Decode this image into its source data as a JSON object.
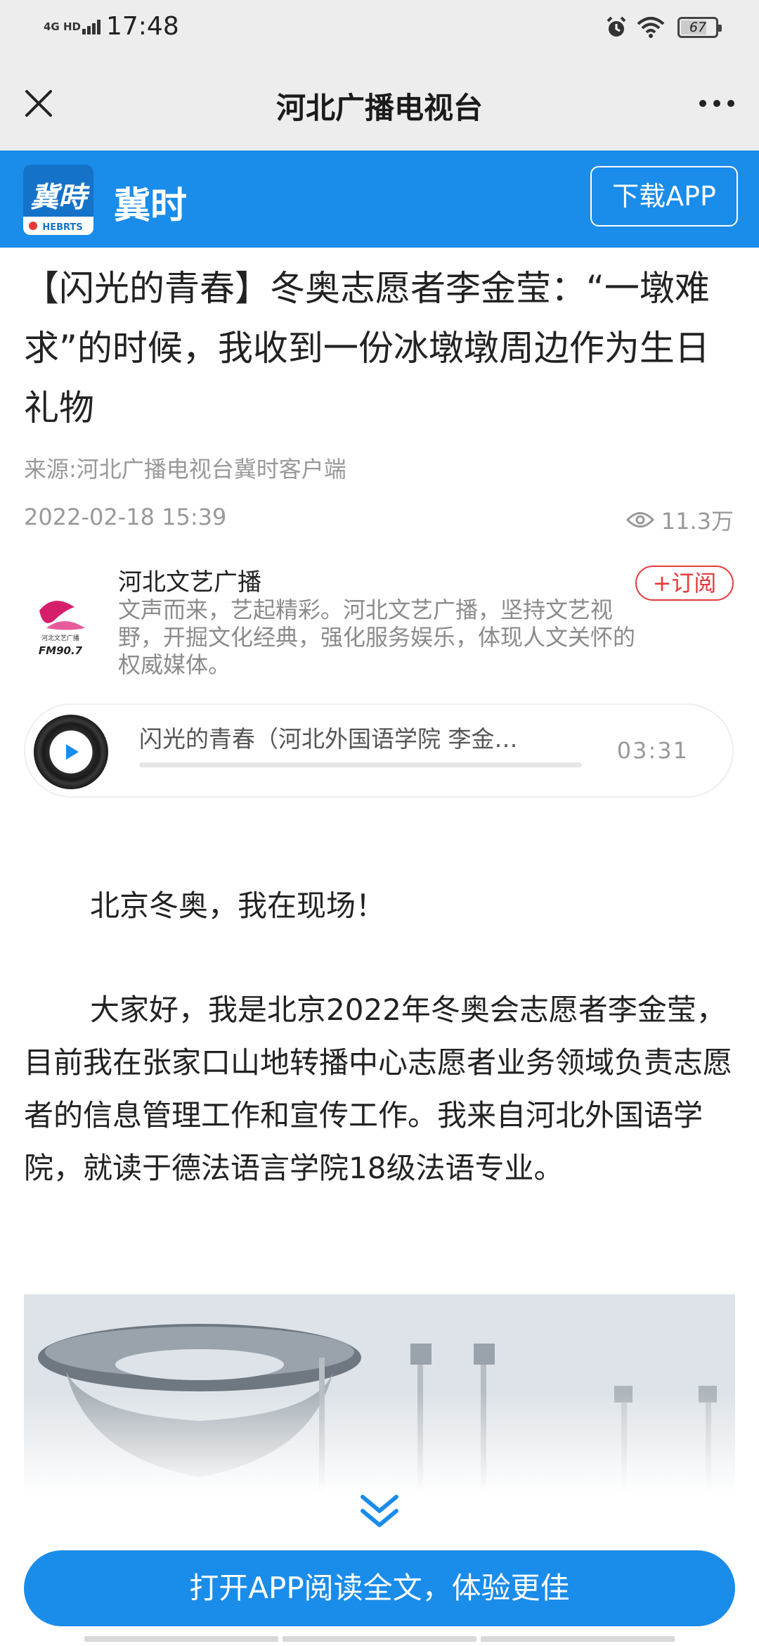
{
  "status_bar": {
    "network": "4G HD",
    "time": "17:48",
    "battery": "67"
  },
  "nav": {
    "title": "河北广播电视台"
  },
  "app_banner": {
    "app_name": "冀时",
    "logo_text": "冀時",
    "logo_sub": "HEBRTS",
    "download_label": "下载APP",
    "brand_color": "#1a8cea"
  },
  "article": {
    "title": "【闪光的青春】冬奥志愿者李金莹：“一墩难求”的时候，我收到一份冰墩墩周边作为生日礼物",
    "source": "来源:河北广播电视台冀时客户端",
    "date": "2022-02-18 15:39",
    "views": "11.3万"
  },
  "author": {
    "name": "河北文艺广播",
    "description": "文声而来，艺起精彩。河北文艺广播，坚持文艺视野，开掘文化经典，强化服务娱乐，体现人文关怀的权威媒体。",
    "logo_text": "河北文艺广播",
    "logo_fm": "FM90.7",
    "subscribe_label": "+订阅"
  },
  "audio": {
    "title": "闪光的青春（河北外国语学院 李金…",
    "duration": "03:31",
    "progress": 0
  },
  "body": {
    "paragraphs": [
      "北京冬奥，我在现场！",
      "大家好，我是北京2022年冬奥会志愿者李金莹，目前我在张家口山地转播中心志愿者业务领域负责志愿者的信息管理工作和宣传工作。我来自河北外国语学院，就读于德法语言学院18级法语专业。"
    ]
  },
  "footer": {
    "open_app_label": "打开APP阅读全文，体验更佳"
  }
}
